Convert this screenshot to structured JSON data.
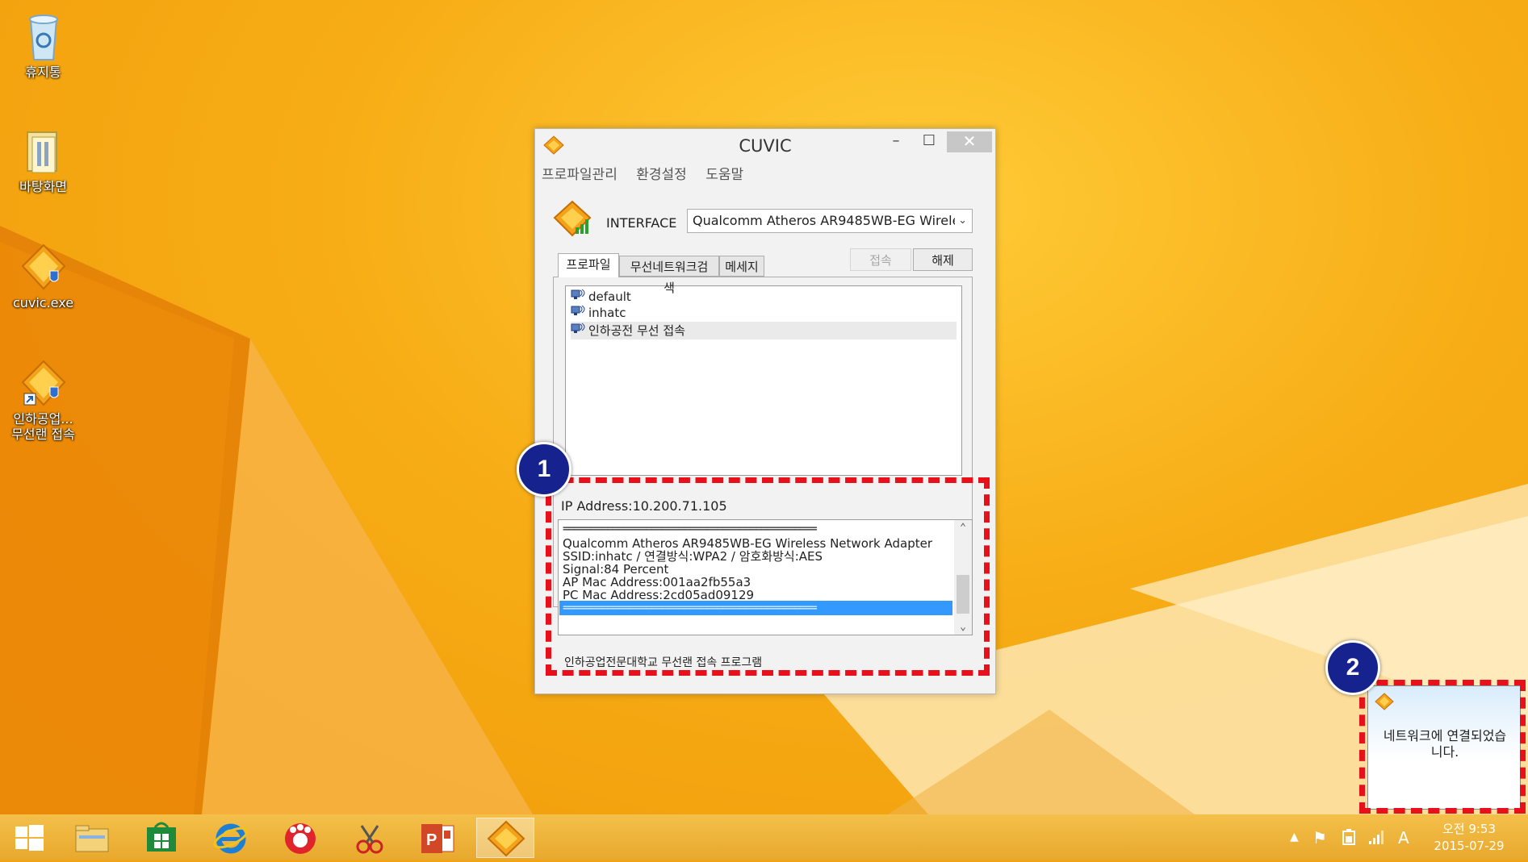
{
  "desktop_icons": [
    {
      "label": "휴지통",
      "icon": "recycle-bin-icon"
    },
    {
      "label": "바탕화면",
      "icon": "folder-icon"
    },
    {
      "label": "cuvic.exe",
      "icon": "cuvic-app-icon"
    },
    {
      "label_line1": "인하공업...",
      "label_line2": "무선랜 접속",
      "icon": "cuvic-shortcut-icon"
    }
  ],
  "window": {
    "title": "CUVIC",
    "controls": {
      "minimize": "–",
      "maximize": "☐",
      "close": "✕"
    },
    "menu": [
      "프로파일관리",
      "환경설정",
      "도움말"
    ],
    "interface_label": "INTERFACE",
    "interface_value": "Qualcomm Atheros AR9485WB-EG Wireles",
    "tabs": [
      "프로파일",
      "무선네트워크검색",
      "메세지"
    ],
    "buttons": {
      "connect": "접속",
      "disconnect": "해제"
    },
    "profiles": [
      "default",
      "inhatc",
      "인하공전 무선 접속"
    ],
    "ip_address": "IP Address:10.200.71.105",
    "log": {
      "separator": "==============================================",
      "lines": [
        "Qualcomm Atheros AR9485WB-EG Wireless Network Adapter",
        "SSID:inhatc / 연결방식:WPA2 / 암호화방식:AES",
        "Signal:84 Percent",
        "AP Mac Address:001aa2fb55a3",
        "PC Mac Address:2cd05ad09129"
      ]
    },
    "status": "인하공업전문대학교 무선랜 접속 프로그램"
  },
  "annotations": {
    "callout1": "1",
    "callout2": "2"
  },
  "toast": {
    "message_line1": "네트워크에 연결되었습",
    "message_line2": "니다."
  },
  "taskbar": {
    "apps": [
      "start-icon",
      "file-explorer-icon",
      "store-icon",
      "internet-explorer-icon",
      "camera-app-icon",
      "snipping-tool-icon",
      "powerpoint-icon",
      "cuvic-app-icon"
    ],
    "clock_line1": "오전 9:53",
    "clock_line2": "2015-07-29",
    "ime": "A"
  }
}
